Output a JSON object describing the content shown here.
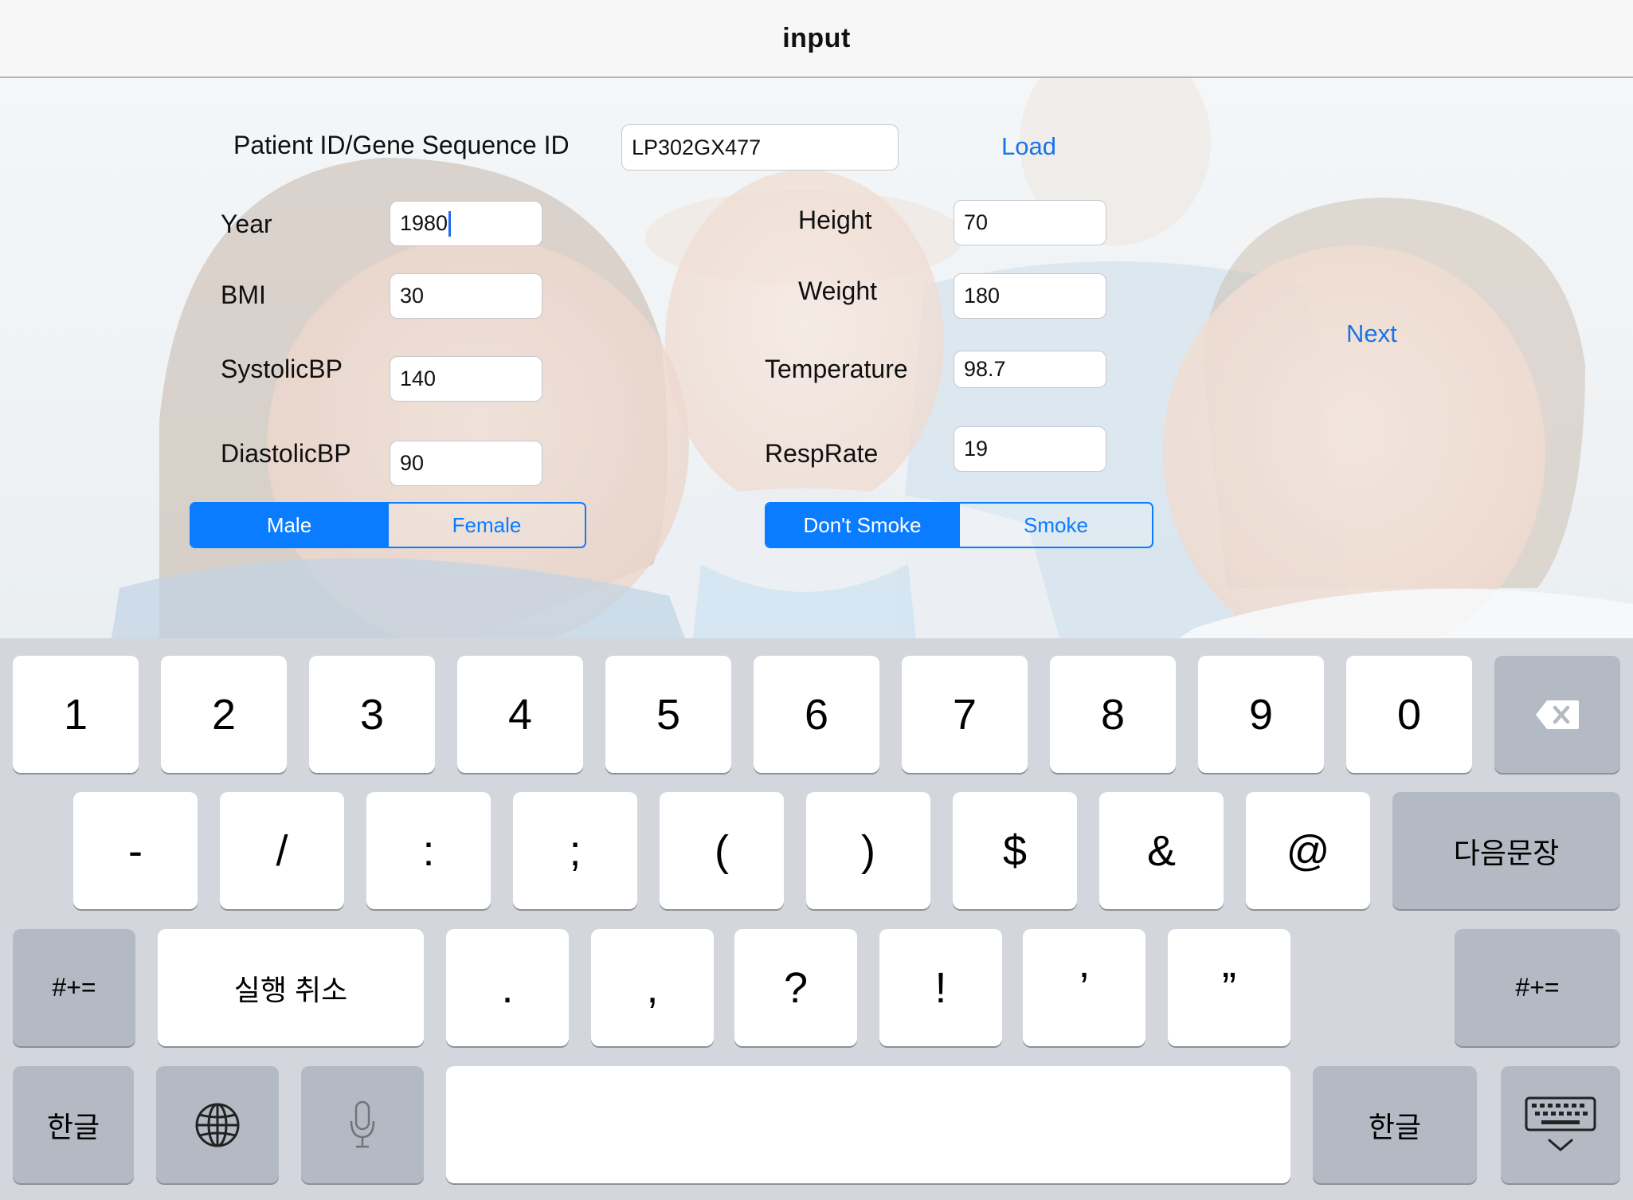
{
  "nav": {
    "title": "input"
  },
  "form": {
    "patient_id_label": "Patient ID/Gene Sequence ID",
    "patient_id_value": "LP302GX477",
    "load_label": "Load",
    "next_label": "Next",
    "year_label": "Year",
    "year_value": "1980",
    "bmi_label": "BMI",
    "bmi_value": "30",
    "systolic_label": "SystolicBP",
    "systolic_value": "140",
    "diastolic_label": "DiastolicBP",
    "diastolic_value": "90",
    "height_label": "Height",
    "height_value": "70",
    "weight_label": "Weight",
    "weight_value": "180",
    "temperature_label": "Temperature",
    "temperature_value": "98.7",
    "resprate_label": "RespRate",
    "resprate_value": "19",
    "gender": {
      "options": [
        "Male",
        "Female"
      ],
      "selected": "Male"
    },
    "smoking": {
      "options": [
        "Don't Smoke",
        "Smoke"
      ],
      "selected": "Don't Smoke"
    }
  },
  "keyboard": {
    "row1": [
      "1",
      "2",
      "3",
      "4",
      "5",
      "6",
      "7",
      "8",
      "9",
      "0"
    ],
    "backspace_icon": "backspace-icon",
    "row2": [
      "-",
      "/",
      ":",
      ";",
      "(",
      ")",
      "$",
      "&",
      "@"
    ],
    "return_label": "다음문장",
    "shift_left": "#+=",
    "undo_label": "실행 취소",
    "row3": [
      ".",
      ",",
      "?",
      "!",
      "’",
      "”"
    ],
    "shift_right": "#+=",
    "lang_left": "한글",
    "globe_icon": "globe-icon",
    "mic_icon": "microphone-icon",
    "space_label": "",
    "lang_right": "한글",
    "dismiss_icon": "keyboard-dismiss-icon"
  },
  "colors": {
    "accent": "#0a7cff",
    "link": "#1a73e8",
    "keyboard_bg": "#d3d7dd"
  }
}
